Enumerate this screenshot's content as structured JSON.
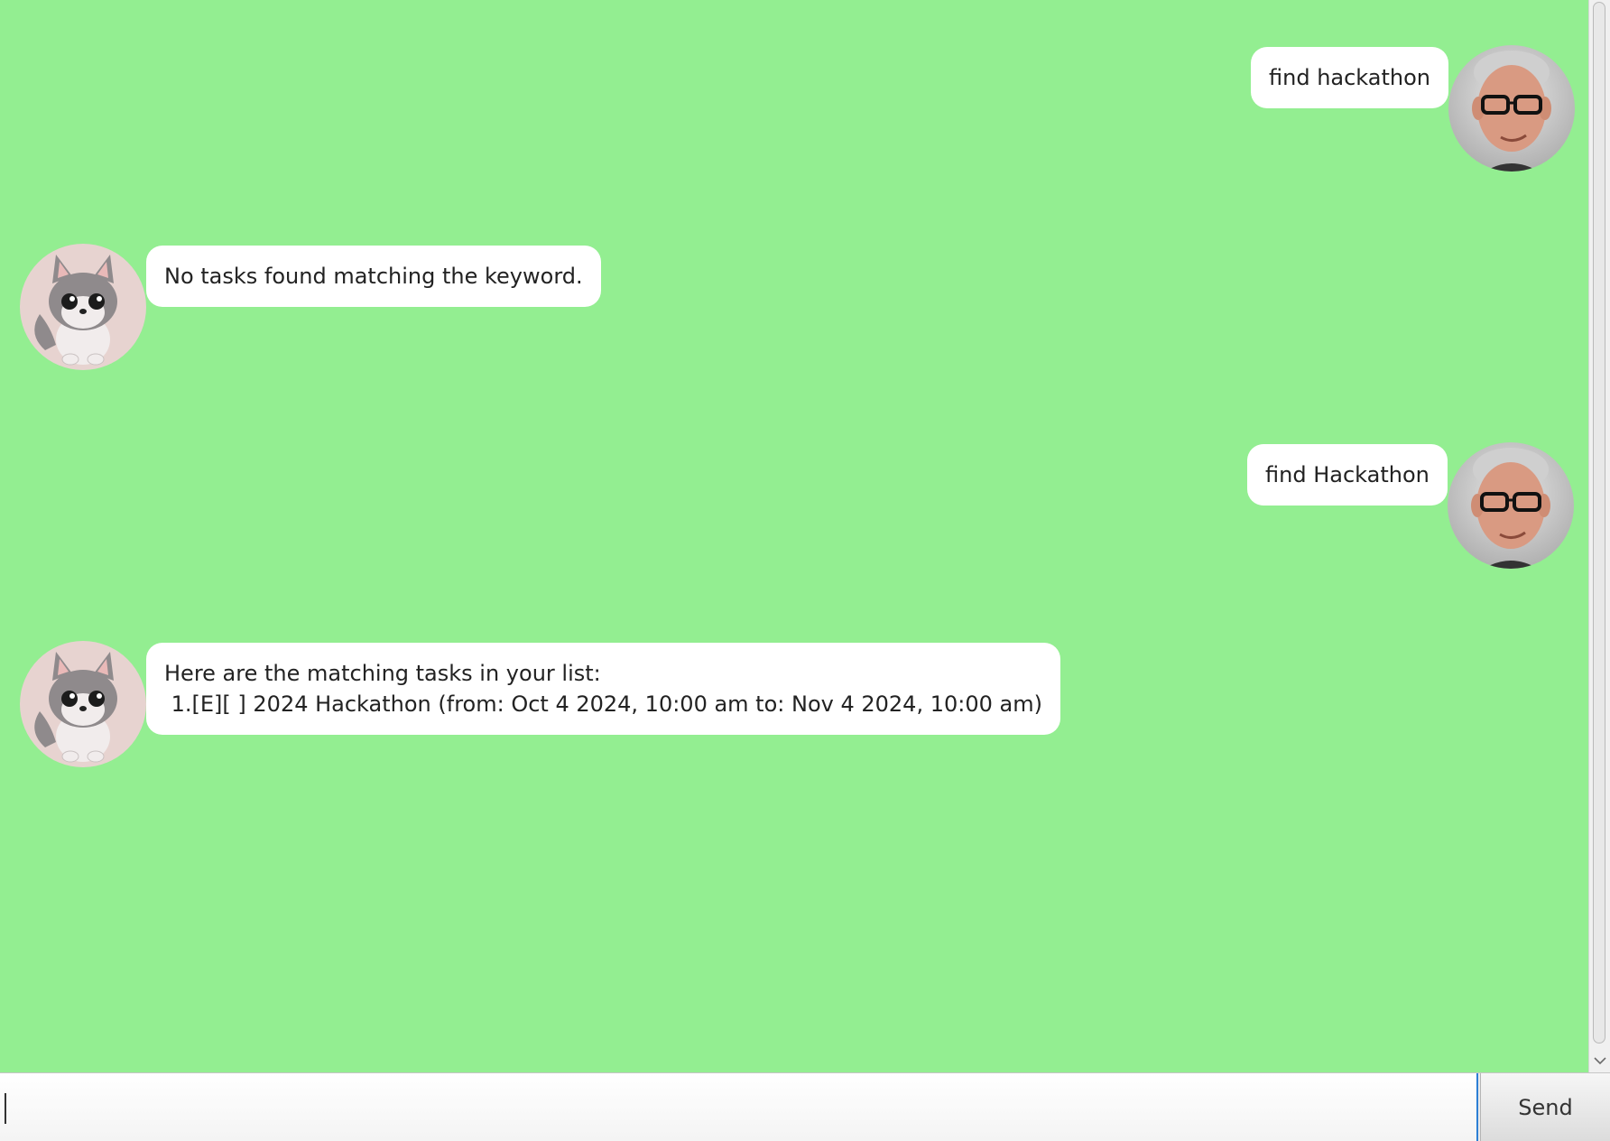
{
  "colors": {
    "chat_background": "#93ee91",
    "bubble_background": "#ffffff",
    "text": "#222222",
    "input_focus_border": "#2c7fd5"
  },
  "messages": [
    {
      "sender": "user",
      "avatar": "user-portrait-icon",
      "text": "find hackathon"
    },
    {
      "sender": "bot",
      "avatar": "wolf-pup-icon",
      "text": "No tasks found matching the keyword."
    },
    {
      "sender": "user",
      "avatar": "user-portrait-icon",
      "text": "find Hackathon"
    },
    {
      "sender": "bot",
      "avatar": "wolf-pup-icon",
      "text": "Here are the matching tasks in your list:\n 1.[E][ ] 2024 Hackathon (from: Oct 4 2024, 10:00 am to: Nov 4 2024, 10:00 am)"
    }
  ],
  "input": {
    "value": "",
    "placeholder": ""
  },
  "send_button": {
    "label": "Send"
  }
}
